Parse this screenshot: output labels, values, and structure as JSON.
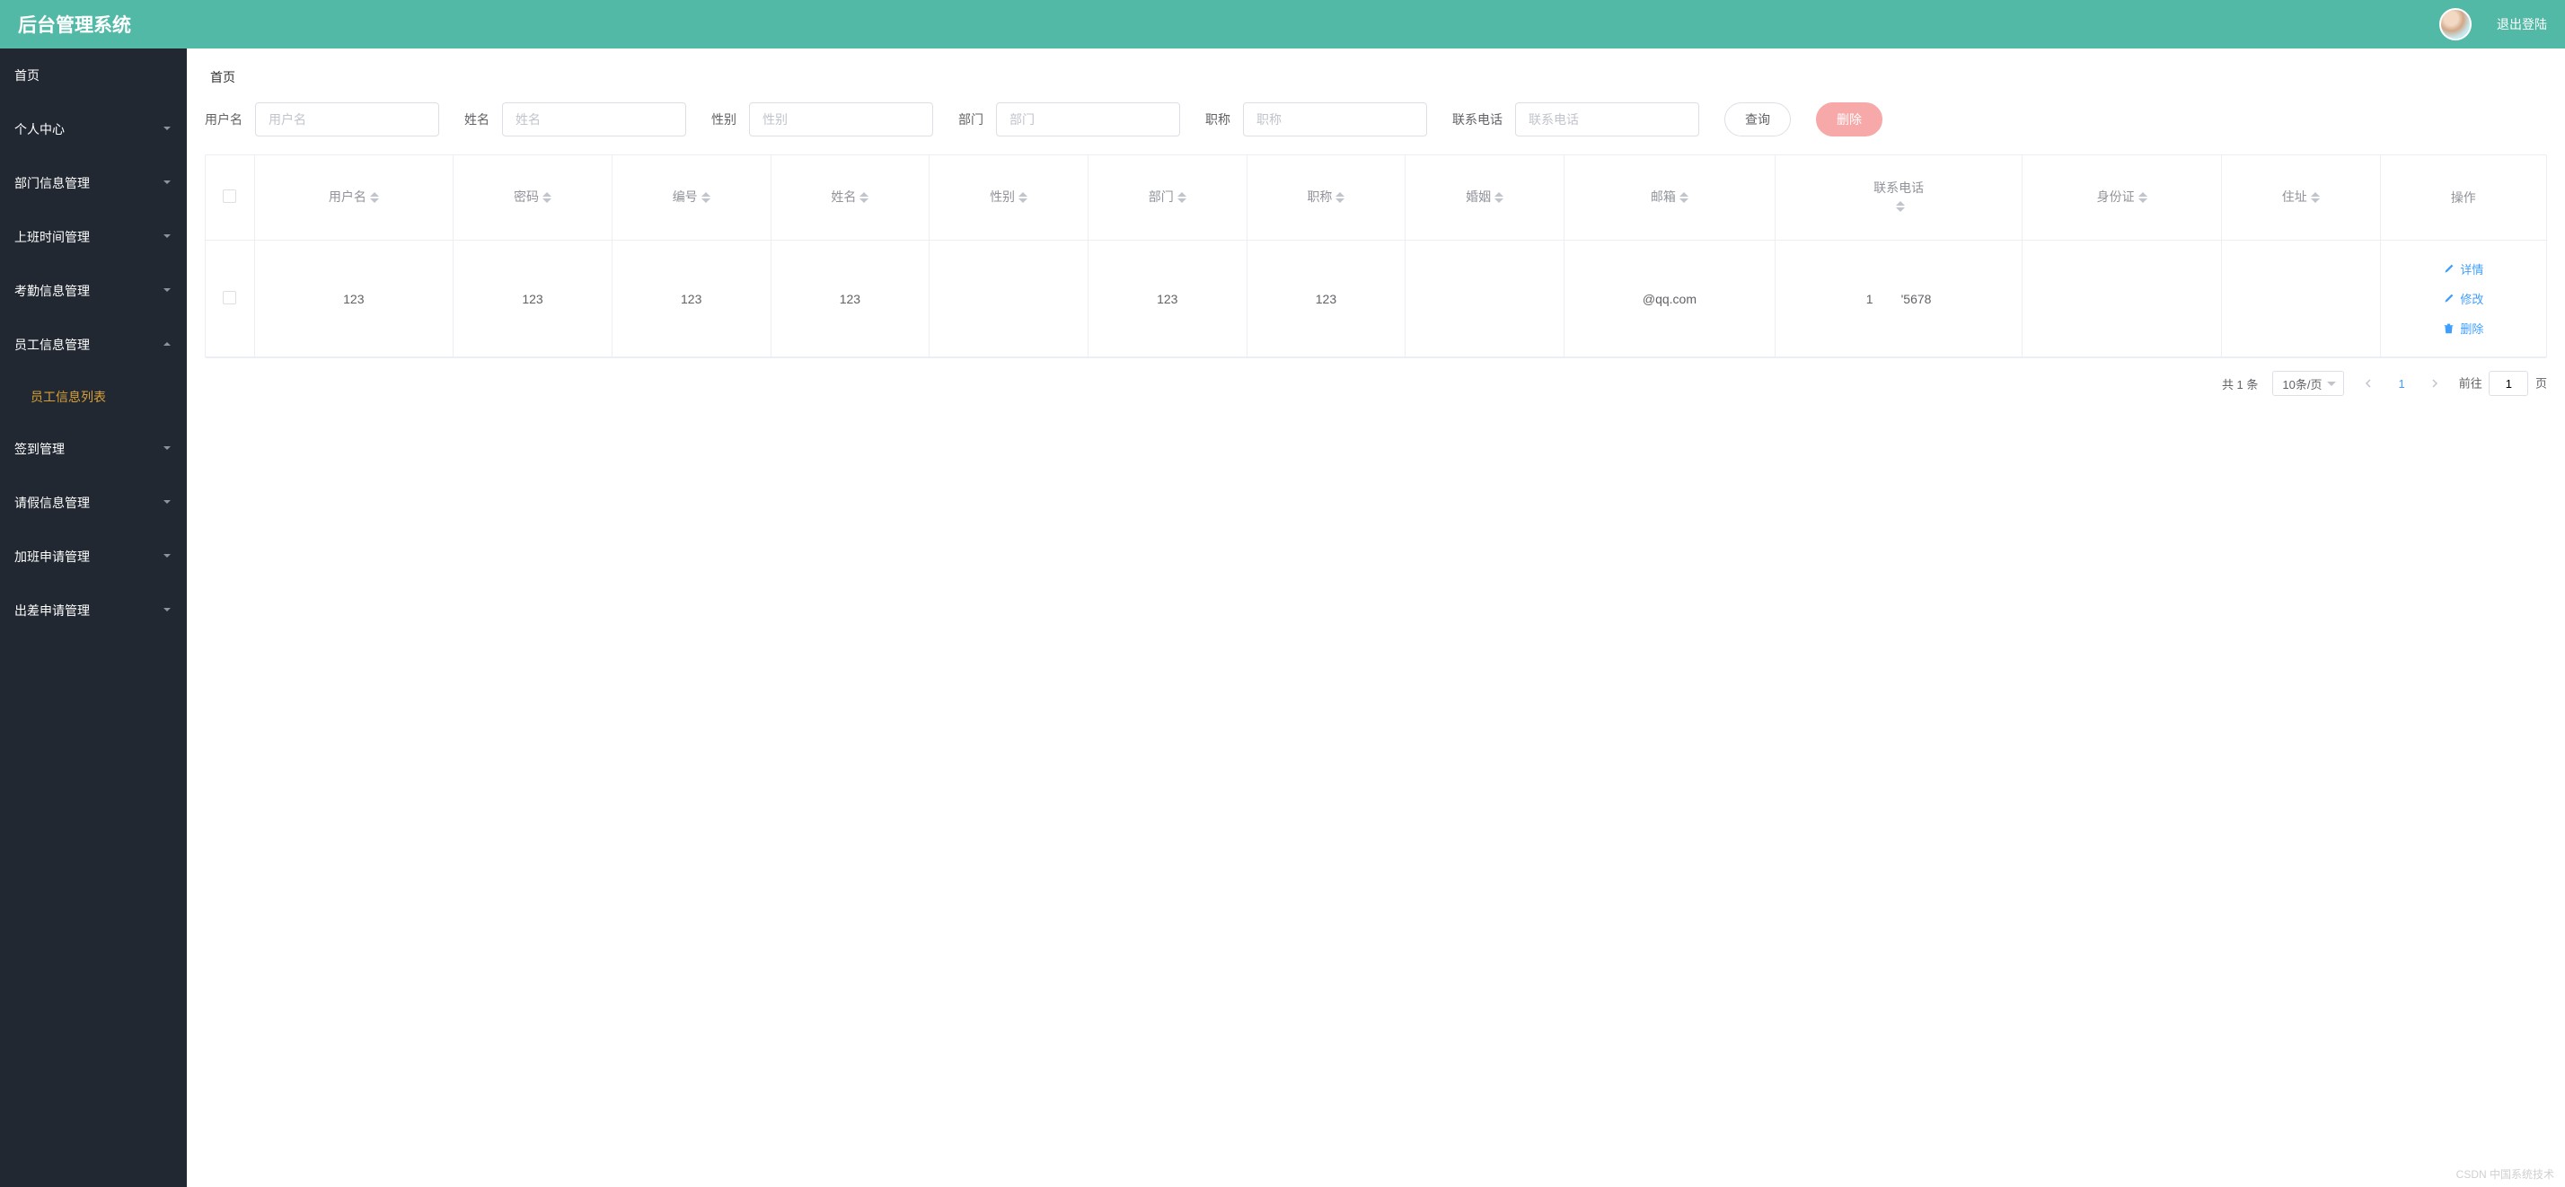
{
  "topbar": {
    "title": "后台管理系统",
    "logout": "退出登陆"
  },
  "sidebar": {
    "items": [
      {
        "label": "首页",
        "expandable": false
      },
      {
        "label": "个人中心",
        "expandable": true
      },
      {
        "label": "部门信息管理",
        "expandable": true
      },
      {
        "label": "上班时间管理",
        "expandable": true
      },
      {
        "label": "考勤信息管理",
        "expandable": true
      },
      {
        "label": "员工信息管理",
        "expandable": true,
        "expanded": true,
        "children": [
          {
            "label": "员工信息列表",
            "active": true
          }
        ]
      },
      {
        "label": "签到管理",
        "expandable": true
      },
      {
        "label": "请假信息管理",
        "expandable": true
      },
      {
        "label": "加班申请管理",
        "expandable": true
      },
      {
        "label": "出差申请管理",
        "expandable": true
      }
    ]
  },
  "breadcrumb": "首页",
  "filters": {
    "username_label": "用户名",
    "username_placeholder": "用户名",
    "name_label": "姓名",
    "name_placeholder": "姓名",
    "gender_label": "性别",
    "gender_placeholder": "性别",
    "department_label": "部门",
    "department_placeholder": "部门",
    "jobtitle_label": "职称",
    "jobtitle_placeholder": "职称",
    "phone_label": "联系电话",
    "phone_placeholder": "联系电话",
    "search_btn": "查询",
    "delete_btn": "删除"
  },
  "table": {
    "columns": [
      "用户名",
      "密码",
      "编号",
      "姓名",
      "性别",
      "部门",
      "职称",
      "婚姻",
      "邮箱",
      "联系电话",
      "身份证",
      "住址",
      "操作"
    ],
    "rows": [
      {
        "username": "123",
        "password": "123",
        "code": "123",
        "name": "123",
        "gender": "",
        "department": "123",
        "jobtitle": "123",
        "marriage": "",
        "email": "@qq.com",
        "phone": "1        '5678",
        "idcard": "",
        "address": ""
      }
    ],
    "actions": {
      "detail": "详情",
      "edit": "修改",
      "delete": "删除"
    }
  },
  "pagination": {
    "total_text": "共 1 条",
    "page_size": "10条/页",
    "current": "1",
    "jump_prefix": "前往",
    "jump_value": "1",
    "jump_suffix": "页"
  },
  "watermark": "CSDN 中国系统技术"
}
